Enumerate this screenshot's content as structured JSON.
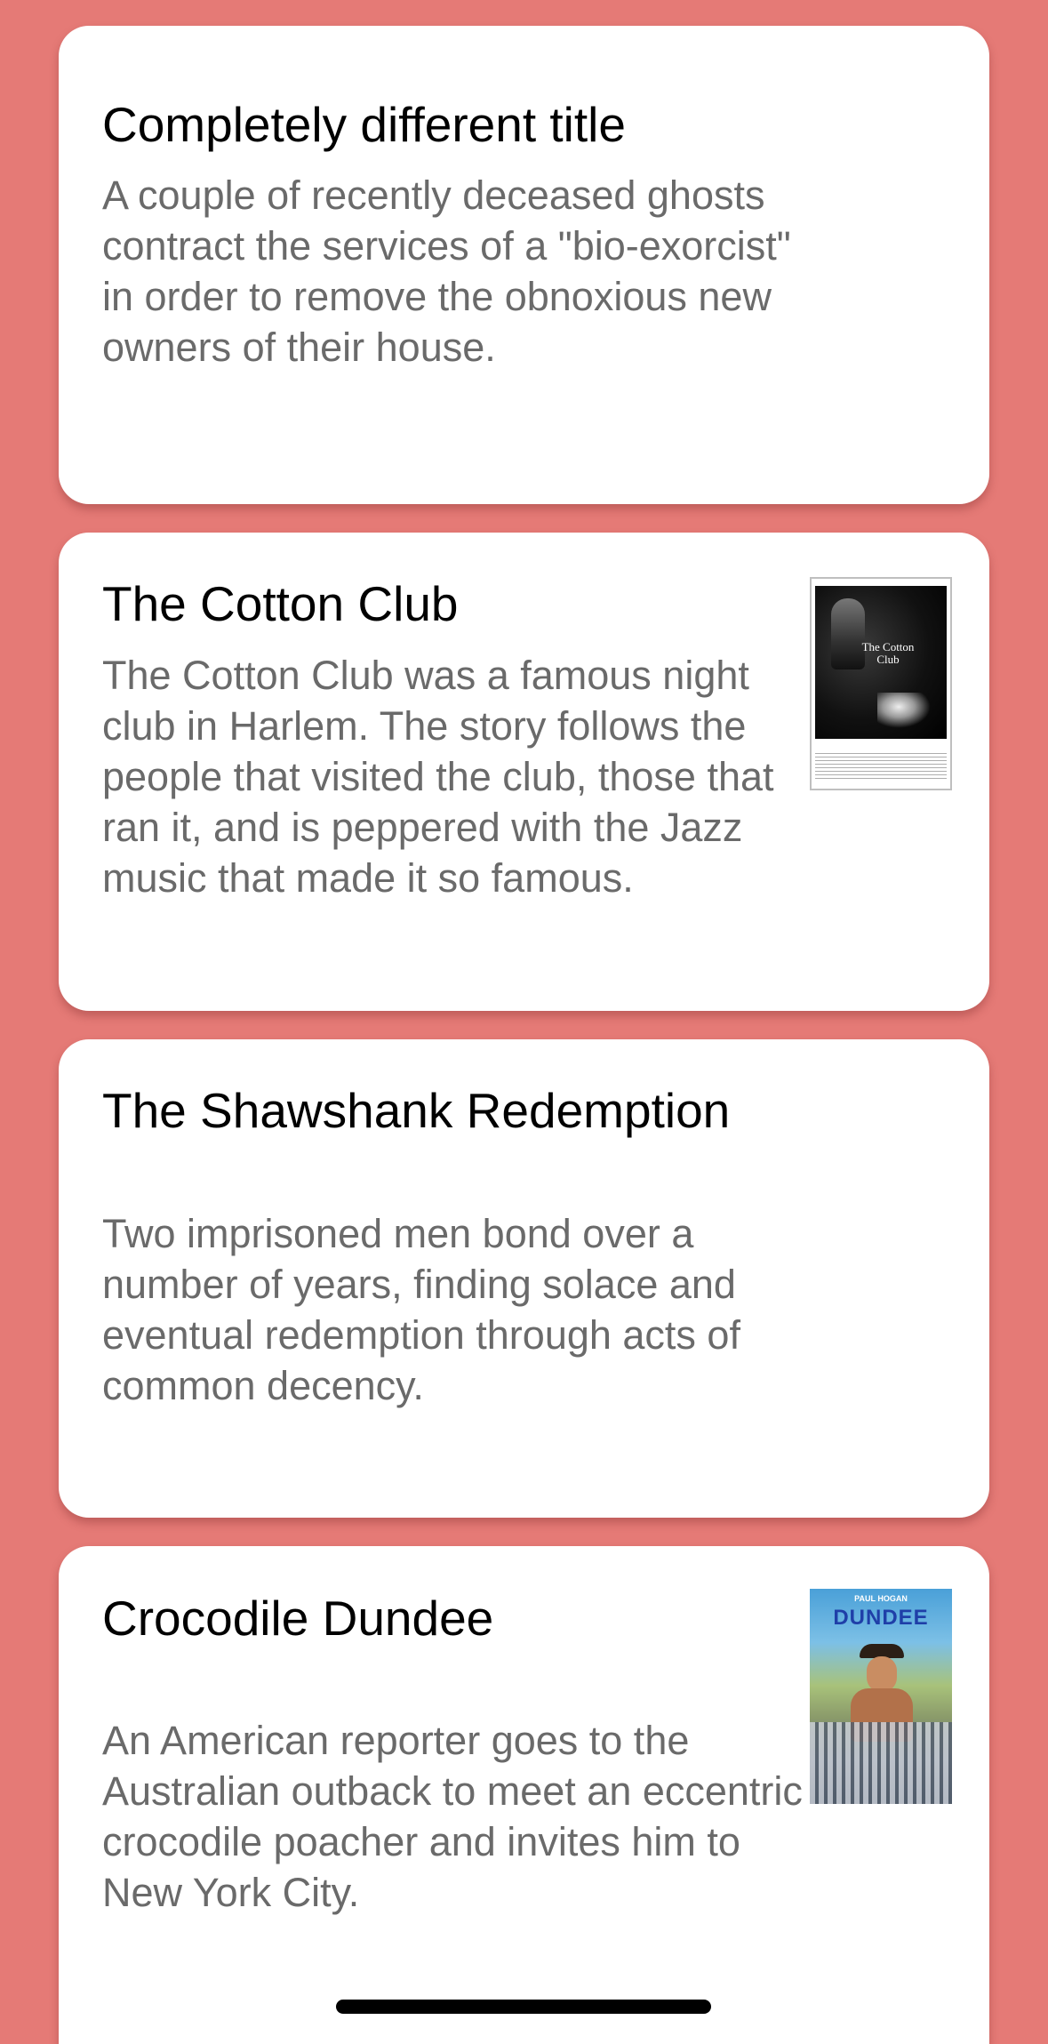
{
  "cards": [
    {
      "title": "Completely different title",
      "description": "A couple of recently deceased ghosts contract the services of a \"bio-exorcist\" in order to remove the obnoxious new owners of their house.",
      "has_poster": false
    },
    {
      "title": "The Cotton Club",
      "description": "The Cotton Club was a famous night club in Harlem. The story follows the people that visited the club, those that ran it, and is peppered with the Jazz music that made it so famous.",
      "has_poster": true,
      "poster": {
        "logo_text": "The Cotton Club"
      }
    },
    {
      "title": "The Shawshank Redemption",
      "description": "Two imprisoned men bond over a number of years, finding solace and eventual redemption through acts of common decency.",
      "has_poster": false
    },
    {
      "title": "Crocodile Dundee",
      "description": "An American reporter goes to the Australian outback to meet an eccentric crocodile poacher and invites him to New York City.",
      "has_poster": true,
      "poster": {
        "top_text": "PAUL HOGAN",
        "title_text": "DUNDEE"
      }
    }
  ],
  "colors": {
    "background": "#e57a76",
    "card": "#ffffff",
    "title": "#000000",
    "description": "#6a6a6a"
  }
}
